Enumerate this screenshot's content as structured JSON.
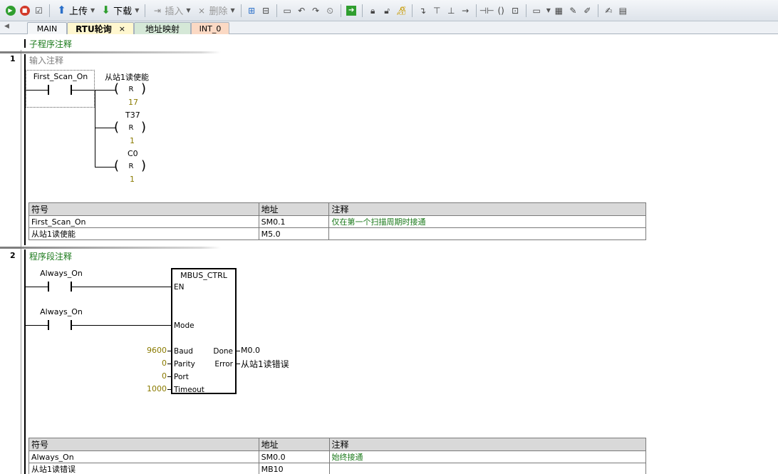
{
  "toolbar": {
    "upload_label": "上传",
    "download_label": "下载",
    "insert_label": "插入",
    "delete_label": "删除"
  },
  "tabs": [
    {
      "label": "MAIN"
    },
    {
      "label": "RTU轮询",
      "close": "×"
    },
    {
      "label": "地址映射"
    },
    {
      "label": "INT_0"
    }
  ],
  "subroutine_comment": "子程序注释",
  "networks": [
    {
      "number": "1",
      "comment": "输入注释",
      "contact": "First_Scan_On",
      "coils": [
        {
          "operand": "从站1读使能",
          "letter": "R",
          "count": "17"
        },
        {
          "operand": "T37",
          "letter": "R",
          "count": "1"
        },
        {
          "operand": "C0",
          "letter": "R",
          "count": "1"
        }
      ],
      "symbol_table": {
        "headers": [
          "符号",
          "地址",
          "注释"
        ],
        "rows": [
          [
            "First_Scan_On",
            "SM0.1",
            "仅在第一个扫描周期时接通"
          ],
          [
            "从站1读使能",
            "M5.0",
            ""
          ]
        ]
      }
    },
    {
      "number": "2",
      "comment": "程序段注释",
      "contacts": [
        "Always_On",
        "Always_On"
      ],
      "block": {
        "title": "MBUS_CTRL",
        "inputs": [
          {
            "pin": "EN",
            "value": ""
          },
          {
            "pin": "Mode",
            "value": ""
          },
          {
            "pin": "Baud",
            "value": "9600"
          },
          {
            "pin": "Parity",
            "value": "0"
          },
          {
            "pin": "Port",
            "value": "0"
          },
          {
            "pin": "Timeout",
            "value": "1000"
          }
        ],
        "outputs": [
          {
            "pin": "Done",
            "value": "M0.0"
          },
          {
            "pin": "Error",
            "value": "从站1读错误"
          }
        ]
      },
      "symbol_table": {
        "headers": [
          "符号",
          "地址",
          "注释"
        ],
        "rows": [
          [
            "Always_On",
            "SM0.0",
            "始终接通"
          ],
          [
            "从站1读错误",
            "MB10",
            ""
          ]
        ]
      }
    }
  ],
  "colors": {
    "comment_green": "#1b7a1b",
    "value_olive": "#8a7a00",
    "tab_active": "#fff7cf",
    "tab_addr": "#d5e8d7",
    "tab_int": "#fbd9c4"
  }
}
